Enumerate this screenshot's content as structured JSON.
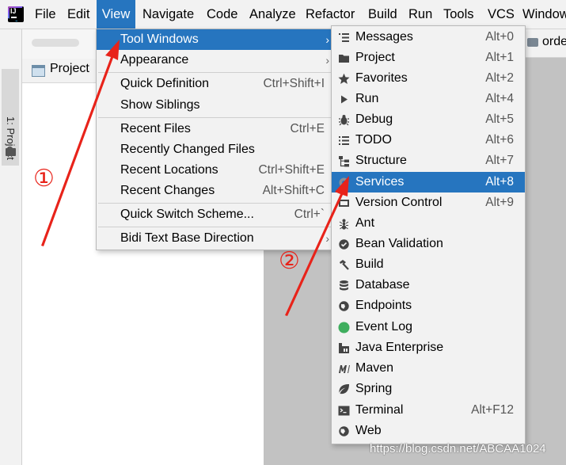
{
  "menubar": {
    "items": [
      {
        "label": "File"
      },
      {
        "label": "Edit"
      },
      {
        "label": "View"
      },
      {
        "label": "Navigate"
      },
      {
        "label": "Code"
      },
      {
        "label": "Analyze"
      },
      {
        "label": "Refactor"
      },
      {
        "label": "Build"
      },
      {
        "label": "Run"
      },
      {
        "label": "Tools"
      },
      {
        "label": "VCS"
      },
      {
        "label": "Window"
      }
    ]
  },
  "sidebar": {
    "vertical_tab": "1: Project"
  },
  "project_panel": {
    "label": "Project"
  },
  "editor_tab": {
    "label": "orde"
  },
  "view_menu": {
    "items": [
      {
        "label": "Tool Windows",
        "shortcut": "",
        "submenu": true
      },
      {
        "label": "Appearance",
        "shortcut": "",
        "submenu": true
      },
      {
        "label": "Quick Definition",
        "shortcut": "Ctrl+Shift+I"
      },
      {
        "label": "Show Siblings",
        "shortcut": ""
      },
      {
        "label": "Recent Files",
        "shortcut": "Ctrl+E"
      },
      {
        "label": "Recently Changed Files",
        "shortcut": ""
      },
      {
        "label": "Recent Locations",
        "shortcut": "Ctrl+Shift+E"
      },
      {
        "label": "Recent Changes",
        "shortcut": "Alt+Shift+C"
      },
      {
        "label": "Quick Switch Scheme...",
        "shortcut": "Ctrl+`"
      },
      {
        "label": "Bidi Text Base Direction",
        "shortcut": "",
        "submenu": true
      }
    ]
  },
  "tool_windows_menu": {
    "items": [
      {
        "label": "Messages",
        "shortcut": "Alt+0",
        "icon": "messages-icon"
      },
      {
        "label": "Project",
        "shortcut": "Alt+1",
        "icon": "folder-icon"
      },
      {
        "label": "Favorites",
        "shortcut": "Alt+2",
        "icon": "star-icon"
      },
      {
        "label": "Run",
        "shortcut": "Alt+4",
        "icon": "run-icon"
      },
      {
        "label": "Debug",
        "shortcut": "Alt+5",
        "icon": "bug-icon"
      },
      {
        "label": "TODO",
        "shortcut": "Alt+6",
        "icon": "todo-icon"
      },
      {
        "label": "Structure",
        "shortcut": "Alt+7",
        "icon": "structure-icon"
      },
      {
        "label": "Services",
        "shortcut": "Alt+8",
        "icon": "services-icon"
      },
      {
        "label": "Version Control",
        "shortcut": "Alt+9",
        "icon": "version-control-icon"
      },
      {
        "label": "Ant",
        "shortcut": "",
        "icon": "ant-icon"
      },
      {
        "label": "Bean Validation",
        "shortcut": "",
        "icon": "bean-validation-icon"
      },
      {
        "label": "Build",
        "shortcut": "",
        "icon": "hammer-icon"
      },
      {
        "label": "Database",
        "shortcut": "",
        "icon": "database-icon"
      },
      {
        "label": "Endpoints",
        "shortcut": "",
        "icon": "globe-icon"
      },
      {
        "label": "Event Log",
        "shortcut": "",
        "icon": "event-log-icon"
      },
      {
        "label": "Java Enterprise",
        "shortcut": "",
        "icon": "java-enterprise-icon"
      },
      {
        "label": "Maven",
        "shortcut": "",
        "icon": "maven-icon"
      },
      {
        "label": "Spring",
        "shortcut": "",
        "icon": "spring-leaf-icon"
      },
      {
        "label": "Terminal",
        "shortcut": "Alt+F12",
        "icon": "terminal-icon"
      },
      {
        "label": "Web",
        "shortcut": "",
        "icon": "web-icon"
      }
    ]
  },
  "annotations": {
    "step1": "①",
    "step2": "②"
  },
  "watermark": "https://blog.csdn.net/ABCAA1024",
  "colors": {
    "highlight": "#2675bf",
    "annotation": "#e8231a",
    "menu_bg": "#f2f2f2",
    "editor_bg": "#c2c2c2"
  }
}
